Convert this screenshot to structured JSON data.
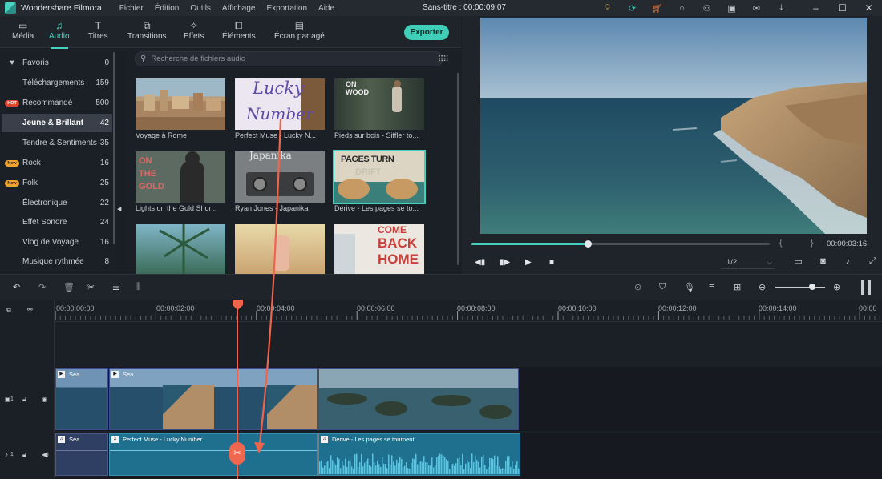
{
  "app": {
    "name": "Wondershare Filmora",
    "doc_title": "Sans-titre : 00:00:09:07"
  },
  "menu": [
    "Fichier",
    "Édition",
    "Outils",
    "Affichage",
    "Exportation",
    "Aide"
  ],
  "toolbar": {
    "tabs": [
      {
        "label": "Média",
        "icon": "folder-icon"
      },
      {
        "label": "Audio",
        "icon": "music-note-icon",
        "active": true
      },
      {
        "label": "Titres",
        "icon": "text-icon"
      },
      {
        "label": "Transitions",
        "icon": "transitions-icon"
      },
      {
        "label": "Effets",
        "icon": "effects-icon"
      },
      {
        "label": "Éléments",
        "icon": "elements-icon"
      },
      {
        "label": "Écran partagé",
        "icon": "split-screen-icon"
      }
    ],
    "export_label": "Exporter"
  },
  "sidebar": {
    "items": [
      {
        "label": "Favoris",
        "count": "0",
        "mark": "heart"
      },
      {
        "label": "Téléchargements",
        "count": "159"
      },
      {
        "label": "Recommandé",
        "count": "500",
        "mark": "hot",
        "badge": "HOT"
      },
      {
        "label": "Jeune & Brillant",
        "count": "42",
        "active": true
      },
      {
        "label": "Tendre & Sentiments",
        "count": "35"
      },
      {
        "label": "Rock",
        "count": "16",
        "mark": "new",
        "badge": "New"
      },
      {
        "label": "Folk",
        "count": "25",
        "mark": "new",
        "badge": "New"
      },
      {
        "label": "Électronique",
        "count": "22"
      },
      {
        "label": "Effet Sonore",
        "count": "24"
      },
      {
        "label": "Vlog de Voyage",
        "count": "16"
      },
      {
        "label": "Musique rythmée",
        "count": "8"
      }
    ]
  },
  "library": {
    "search_placeholder": "Recherche de fichiers audio",
    "items": [
      {
        "label": "Voyage à Rome",
        "art": "city"
      },
      {
        "label": "Perfect Muse - Lucky N...",
        "art": "lucky",
        "art_text": [
          "Lucky",
          "Number"
        ]
      },
      {
        "label": "Pieds sur bois - Siffler to...",
        "art": "wood",
        "art_text": [
          "ON",
          "WOOD"
        ]
      },
      {
        "label": "Lights on the Gold Shor...",
        "art": "gold",
        "art_text": [
          "ON",
          "THE",
          "GOLD"
        ]
      },
      {
        "label": "Ryan Jones - Japanika",
        "art": "japanika",
        "art_text": [
          "Japanika"
        ]
      },
      {
        "label": "Dérive - Les pages se to...",
        "art": "pages",
        "art_text": [
          "PAGES TURN",
          "DRIFT"
        ],
        "selected": true
      },
      {
        "label": "",
        "art": "palm"
      },
      {
        "label": "",
        "art": "person"
      },
      {
        "label": "",
        "art": "home",
        "art_text": [
          "COME",
          "BACK",
          "HOME"
        ]
      }
    ]
  },
  "preview": {
    "timecode": "00:00:03:16",
    "progress": 0.39,
    "ratio": "1/2",
    "braces": "{ }"
  },
  "ruler": {
    "ticks": [
      "00:00:00:00",
      "00:00:02:00",
      "00:00:04:00",
      "00:00:06:00",
      "00:00:08:00",
      "00:00:10:00",
      "00:00:12:00",
      "00:00:14:00",
      "00:00"
    ]
  },
  "tracks": {
    "video_label": "1",
    "audio_label": "1",
    "video_clips": [
      {
        "title": "Sea",
        "kind": "sea"
      },
      {
        "title": "Sea",
        "kind": "sea"
      },
      {
        "title": "",
        "kind": "islands"
      }
    ],
    "audio_clips": [
      {
        "title": "Sea"
      },
      {
        "title": "Perfect Muse - Lucky Number"
      },
      {
        "title": "Dérive - Les pages se tournent"
      }
    ]
  },
  "colors": {
    "accent": "#45d1bd",
    "playhead": "#f0644c",
    "export_bg": "#3fcfb8",
    "audio_clip": "#1f6f8e"
  }
}
